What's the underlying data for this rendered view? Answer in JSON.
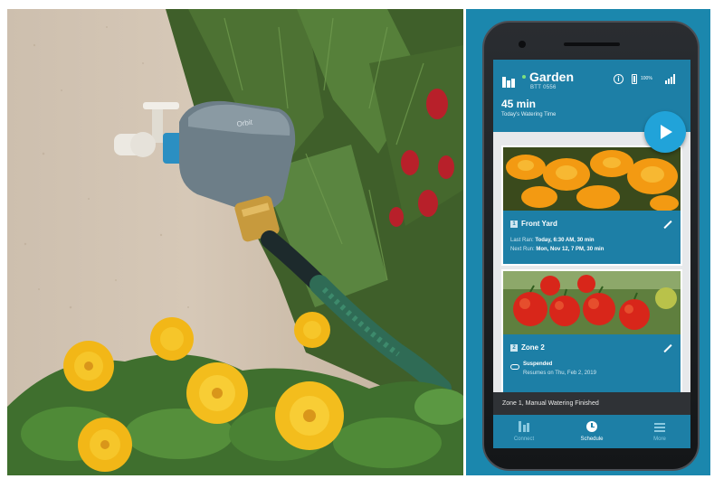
{
  "app": {
    "garden_name": "Garden",
    "device_id": "BTT 0556",
    "battery_percent": "100%",
    "watering_time": "45 min",
    "watering_time_label": "Today's Watering Time"
  },
  "zones": [
    {
      "number": "1",
      "name": "Front Yard",
      "last_run_label": "Last Ran:",
      "last_run_value": "Today, 6:30 AM, 30 min",
      "next_run_label": "Next Run:",
      "next_run_value": "Mon, Nov 12, 7 PM, 30 min"
    },
    {
      "number": "2",
      "name": "Zone 2",
      "status": "Suspended",
      "status_detail": "Resumes on Thu, Feb 2, 2019"
    }
  ],
  "toast": "Zone 1, Manual Watering Finished",
  "nav": {
    "connect": "Connect",
    "schedule": "Schedule",
    "more": "More"
  },
  "device_brand": "Orbit",
  "colors": {
    "panel": "#1b87ad",
    "header": "#1d7fa6",
    "play_button": "#21a3d9",
    "toast": "#2f3236"
  }
}
